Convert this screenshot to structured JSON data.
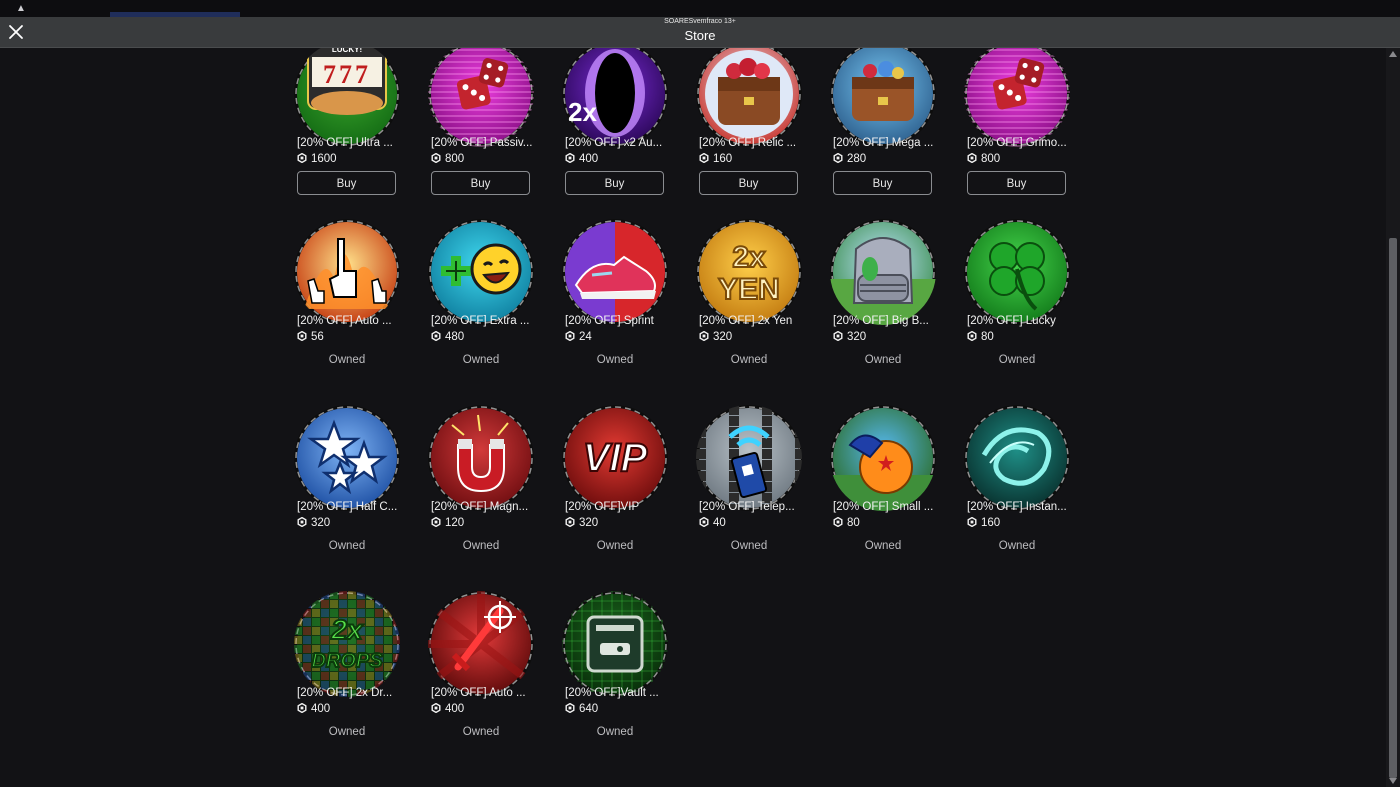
{
  "window": {
    "username": "SOARESvemfraco 13+",
    "title": "Store"
  },
  "colors": {
    "background": "#121215",
    "header": "#393b3d",
    "text": "#f2f2f2",
    "button_border": "#8a8c90"
  },
  "rows": [
    [
      {
        "name": "[20% OFF] Ultra ...",
        "price": "1600",
        "status": "Buy",
        "icon": "lucky-777-icon"
      },
      {
        "name": "[20% OFF] Passiv...",
        "price": "800",
        "status": "Buy",
        "icon": "dice-icon"
      },
      {
        "name": "[20% OFF] x2 Au...",
        "price": "400",
        "status": "Buy",
        "icon": "x2-aura-icon"
      },
      {
        "name": "[20% OFF] Relic ...",
        "price": "160",
        "status": "Buy",
        "icon": "relic-bag-icon"
      },
      {
        "name": "[20% OFF] Mega ...",
        "price": "280",
        "status": "Buy",
        "icon": "mega-bag-icon"
      },
      {
        "name": "[20% OFF] Grimo...",
        "price": "800",
        "status": "Buy",
        "icon": "dice-icon"
      }
    ],
    [
      {
        "name": "[20% OFF] Auto ...",
        "price": "56",
        "status": "Owned",
        "icon": "auto-click-hand-icon"
      },
      {
        "name": "[20% OFF] Extra ...",
        "price": "480",
        "status": "Owned",
        "icon": "extra-smiley-icon"
      },
      {
        "name": "[20% OFF] Sprint",
        "price": "24",
        "status": "Owned",
        "icon": "sprint-shoe-icon"
      },
      {
        "name": "[20% OFF] 2x Yen",
        "price": "320",
        "status": "Owned",
        "icon": "2x-yen-icon"
      },
      {
        "name": "[20% OFF] Big B...",
        "price": "320",
        "status": "Owned",
        "icon": "big-backpack-icon"
      },
      {
        "name": "[20% OFF] Lucky",
        "price": "80",
        "status": "Owned",
        "icon": "clover-icon"
      }
    ],
    [
      {
        "name": "[20% OFF] Half C...",
        "price": "320",
        "status": "Owned",
        "icon": "stars-icon"
      },
      {
        "name": "[20% OFF] Magn...",
        "price": "120",
        "status": "Owned",
        "icon": "magnet-icon"
      },
      {
        "name": "[20% OFF]VIP",
        "price": "320",
        "status": "Owned",
        "icon": "vip-icon"
      },
      {
        "name": "[20% OFF] Telep...",
        "price": "40",
        "status": "Owned",
        "icon": "teleport-remote-icon"
      },
      {
        "name": "[20% OFF] Small ...",
        "price": "80",
        "status": "Owned",
        "icon": "dragon-ball-bag-icon"
      },
      {
        "name": "[20% OFF] Instan...",
        "price": "160",
        "status": "Owned",
        "icon": "instant-swirl-icon"
      }
    ],
    [
      {
        "name": "[20% OFF] 2x Dr...",
        "price": "400",
        "status": "Owned",
        "icon": "2x-drops-icon"
      },
      {
        "name": "[20% OFF] Auto ...",
        "price": "400",
        "status": "Owned",
        "icon": "auto-sword-icon"
      },
      {
        "name": "[20% OFF]Vault ...",
        "price": "640",
        "status": "Owned",
        "icon": "vault-icon"
      }
    ]
  ],
  "icon_text": {
    "lucky": "LUCKY!",
    "sevens": "777",
    "x2": "2x",
    "yen_top": "2x",
    "yen_bottom": "YEN",
    "vip": "VIP",
    "drops_top": "2x",
    "drops_bottom": "DROPS"
  }
}
